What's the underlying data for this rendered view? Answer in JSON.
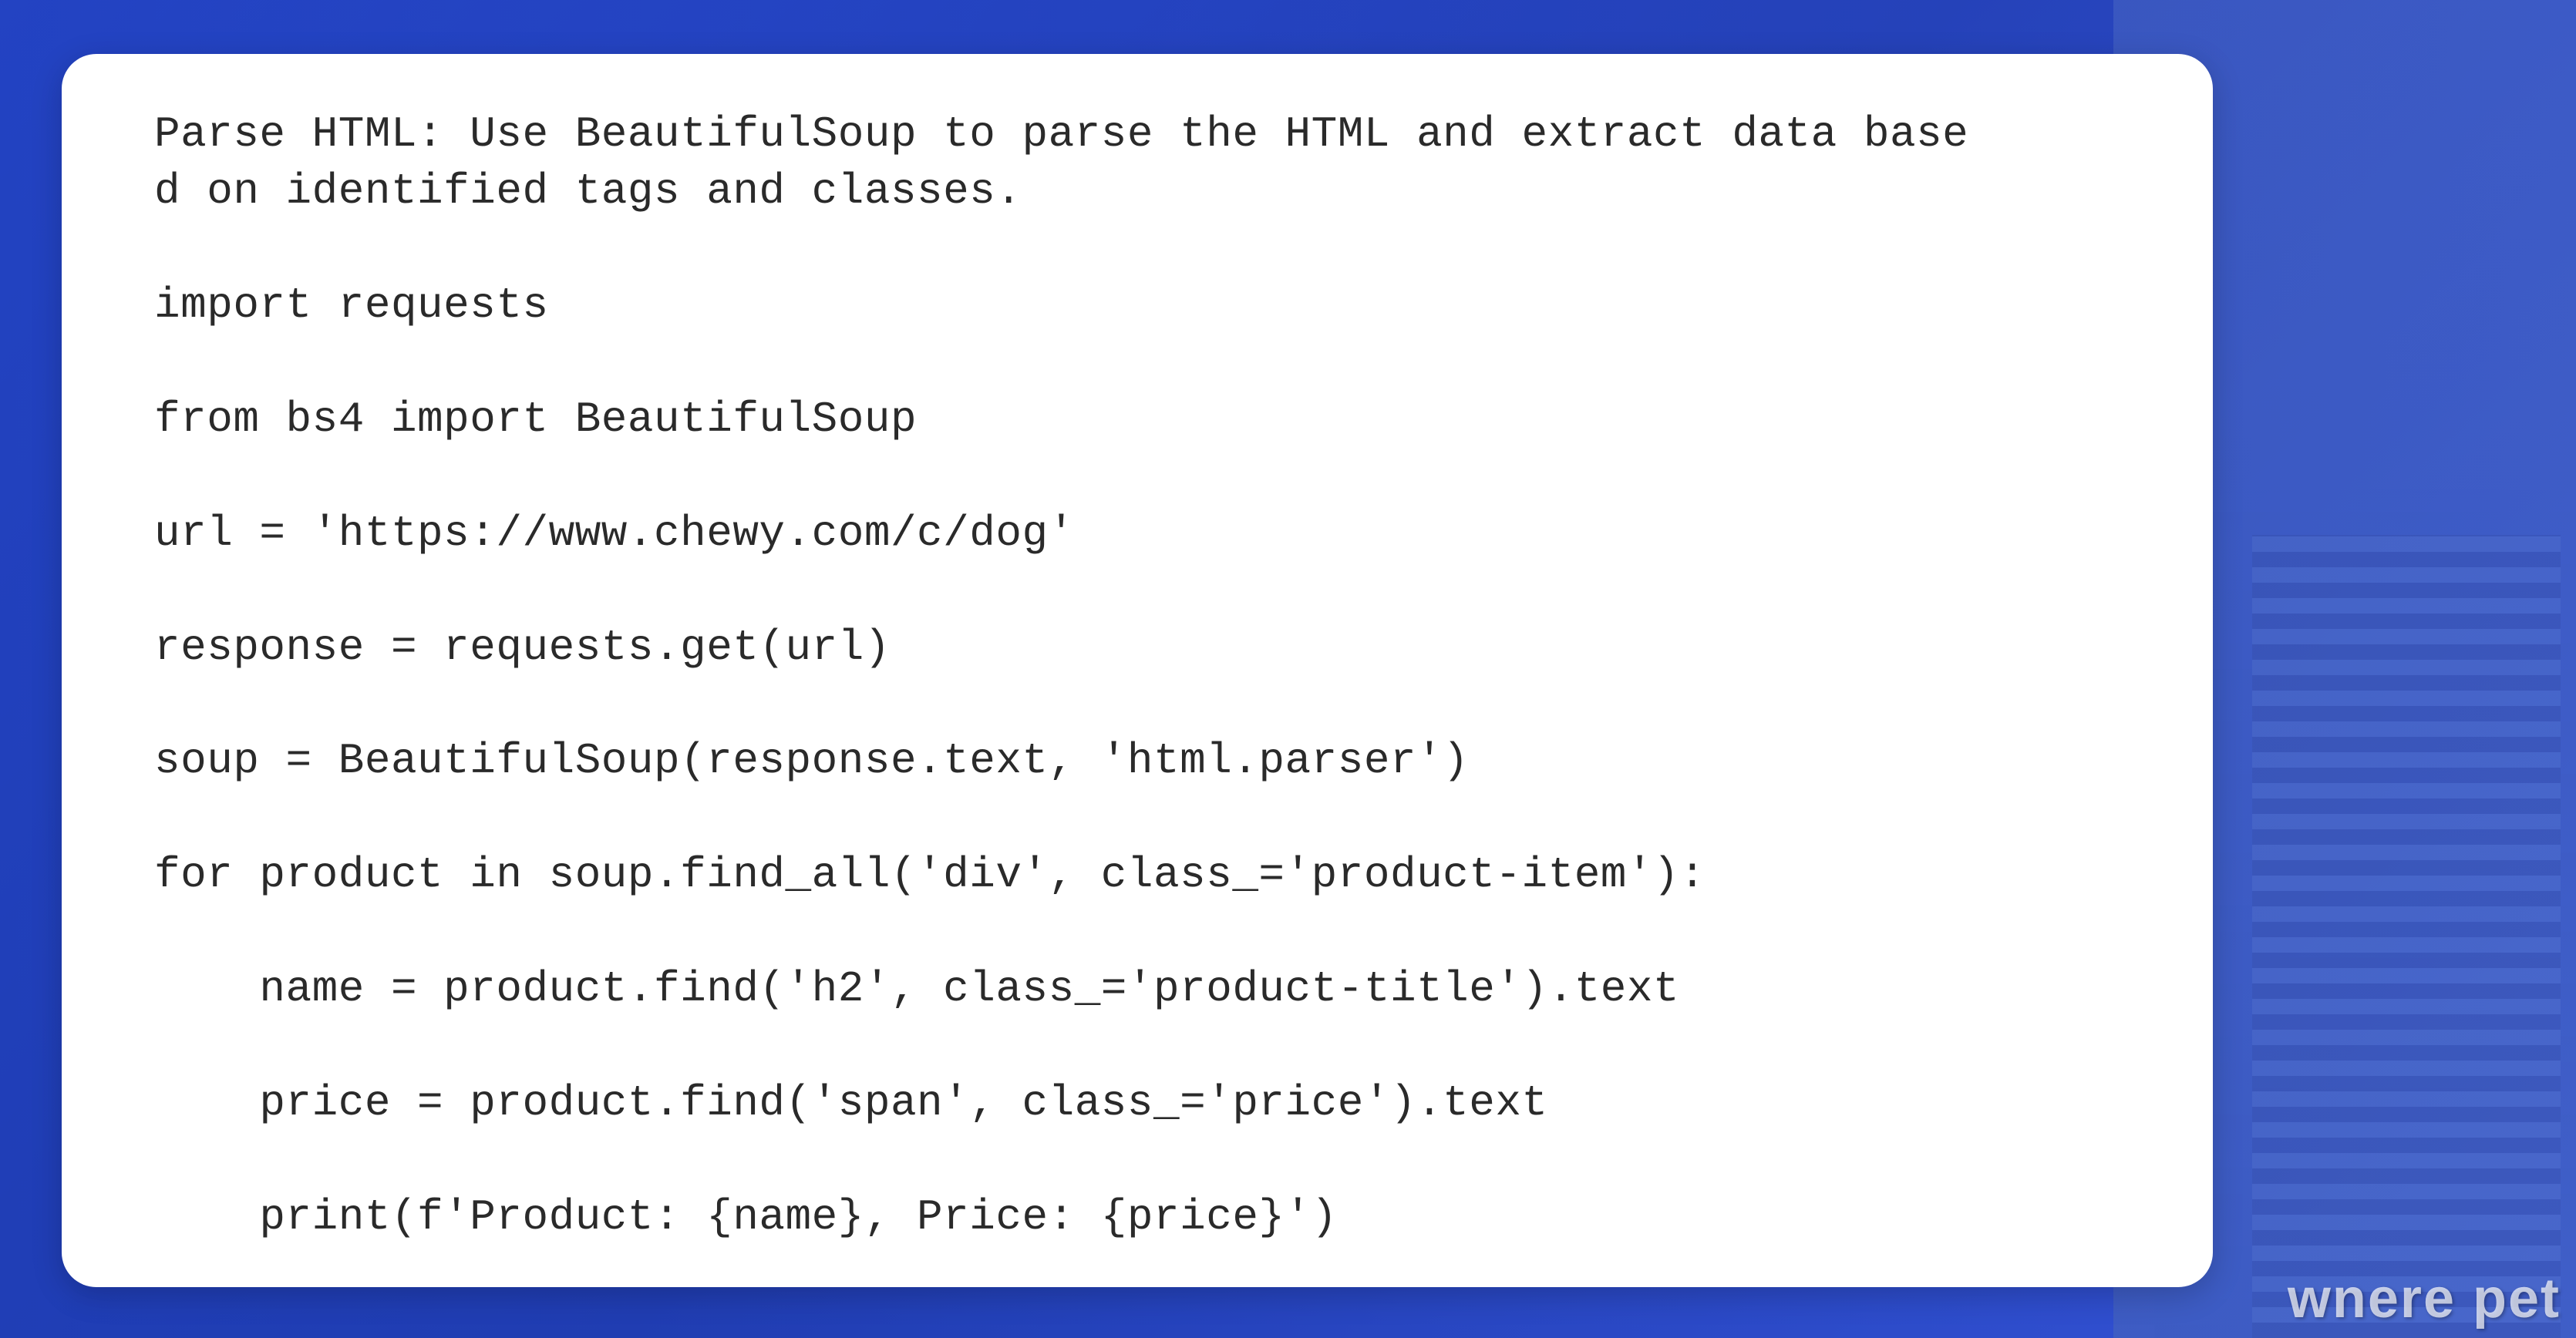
{
  "code": {
    "comment_line1": "Parse HTML: Use BeautifulSoup to parse the HTML and extract data base",
    "comment_line2": "d on identified tags and classes.",
    "import1": "import requests",
    "import2": "from bs4 import BeautifulSoup",
    "url_line": "url = 'https://www.chewy.com/c/dog'",
    "response_line": "response = requests.get(url)",
    "soup_line": "soup = BeautifulSoup(response.text, 'html.parser')",
    "for_line": "for product in soup.find_all('div', class_='product-item'):",
    "name_line": "    name = product.find('h2', class_='product-title').text",
    "price_line": "    price = product.find('span', class_='price').text",
    "print_line": "    print(f'Product: {name}, Price: {price}')"
  },
  "watermark": "wnere pet"
}
